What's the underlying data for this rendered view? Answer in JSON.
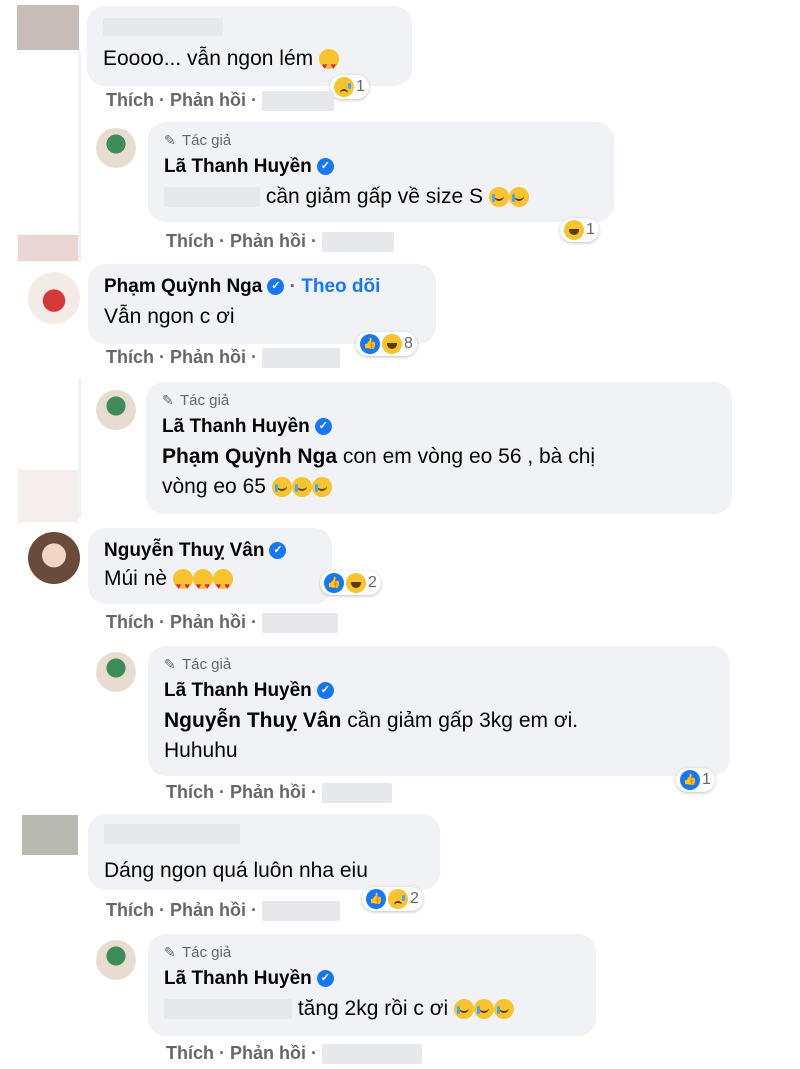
{
  "actions": {
    "like": "Thích",
    "reply": "Phản hồi",
    "sep": "·"
  },
  "author_badge": "Tác giả",
  "follow_label": "Theo dõi",
  "comments": [
    {
      "text": "Eoooo... vẫn ngon lém",
      "reaction_count": "1"
    },
    {
      "name": "Lã Thanh Huyền",
      "text": "cần giảm gấp về size S",
      "reaction_count": "1"
    },
    {
      "name": "Phạm Quỳnh Nga",
      "text": "Vẫn ngon c ơi",
      "reaction_count": "8"
    },
    {
      "name": "Lã Thanh Huyền",
      "mention": "Phạm Quỳnh Nga",
      "text": "con em vòng eo 56 , bà chị",
      "text2": "vòng eo 65"
    },
    {
      "name": "Nguyễn Thuỵ Vân",
      "text": "Múi nè",
      "reaction_count": "2"
    },
    {
      "name": "Lã Thanh Huyền",
      "mention": "Nguyễn Thuỵ Vân",
      "text": "cần giảm gấp 3kg em ơi.",
      "text2": "Huhuhu",
      "reaction_count": "1"
    },
    {
      "text": "Dáng ngon quá luôn nha eiu",
      "reaction_count": "2"
    },
    {
      "name": "Lã Thanh Huyền",
      "text": "tăng 2kg rồi c ơi"
    }
  ],
  "colors": {
    "bubble": "#f0f2f5",
    "link": "#1877f2",
    "secondary": "#65676b",
    "verified": "#1877f2"
  }
}
